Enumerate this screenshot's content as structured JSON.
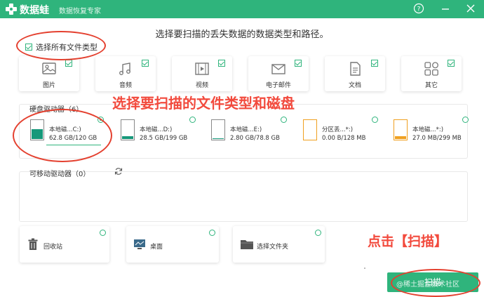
{
  "app": {
    "name": "数据蛙",
    "subtitle": "数据恢复专家"
  },
  "titlebar": {
    "help_glyph": "?",
    "minimize_glyph": "—",
    "close_glyph": "✕"
  },
  "heading": "选择要扫描的丢失数据的数据类型和路径。",
  "select_all": "选择所有文件类型",
  "file_types": [
    {
      "label": "图片",
      "icon": "image-icon"
    },
    {
      "label": "音频",
      "icon": "music-icon"
    },
    {
      "label": "视频",
      "icon": "video-icon"
    },
    {
      "label": "电子邮件",
      "icon": "email-icon"
    },
    {
      "label": "文档",
      "icon": "document-icon"
    },
    {
      "label": "其它",
      "icon": "other-icon"
    }
  ],
  "hard_drives": {
    "title": "硬盘驱动器（6）",
    "drives": [
      {
        "name": "本地磁...C:)",
        "size": "62.8 GB/120 GB",
        "selected": true
      },
      {
        "name": "本地磁...D:)",
        "size": "28.5 GB/199 GB",
        "selected": false
      },
      {
        "name": "本地磁...E:)",
        "size": "2.80 GB/78.8 GB",
        "selected": false
      },
      {
        "name": "分区丢...*:)",
        "size": "0.00  B/128 MB",
        "selected": false
      },
      {
        "name": "本地磁...*:)",
        "size": "27.0 MB/299 MB",
        "selected": false
      }
    ]
  },
  "removable": {
    "title": "可移动驱动器（0）"
  },
  "locations": [
    {
      "label": "回收站",
      "icon": "recycle-bin-icon"
    },
    {
      "label": "桌面",
      "icon": "desktop-icon"
    },
    {
      "label": "选择文件夹",
      "icon": "folder-icon"
    }
  ],
  "annotations": {
    "main": "选择要扫描的文件类型和磁盘",
    "click": "点击【扫描】"
  },
  "scan_button": "扫描",
  "watermark": "@稀土掘金技术社区",
  "colors": {
    "accent": "#2fb47c",
    "annotation": "#f24a3d",
    "drive_fill": "#16987a",
    "partition_fill": "#f0a020"
  }
}
